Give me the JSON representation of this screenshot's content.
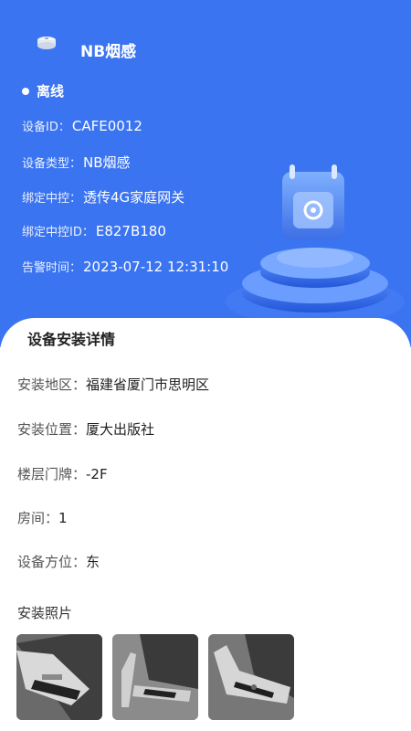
{
  "header": {
    "device_name": "NB烟感",
    "status": "离线",
    "rows": [
      {
        "label": "设备ID：",
        "value": "CAFE0012"
      },
      {
        "label": "设备类型：",
        "value": "NB烟感"
      },
      {
        "label": "绑定中控：",
        "value": "透传4G家庭网关"
      },
      {
        "label": "绑定中控ID：",
        "value": "E827B180"
      },
      {
        "label": "告警时间：",
        "value": "2023-07-12 12:31:10"
      }
    ]
  },
  "details": {
    "title": "设备安装详情",
    "rows": [
      {
        "label": "安装地区：",
        "value": "福建省厦门市思明区"
      },
      {
        "label": "安装位置：",
        "value": "厦大出版社"
      },
      {
        "label": "楼层门牌：",
        "value": "-2F"
      },
      {
        "label": "房间：",
        "value": "1"
      },
      {
        "label": "设备方位：",
        "value": "东"
      }
    ],
    "photos_title": "安装照片"
  },
  "colors": {
    "header_bg": "#3a74f0",
    "card_bg": "#ffffff"
  },
  "icons": {
    "device": "smoke-detector-icon",
    "illustration": "calendar-gear-on-podium"
  }
}
